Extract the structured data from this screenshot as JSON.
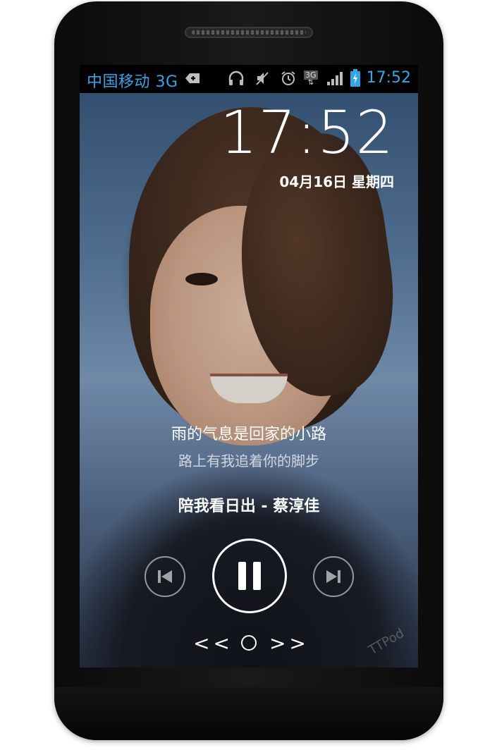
{
  "statusbar": {
    "carrier": "中国移动 3G",
    "network_badge": "3G",
    "time": "17:52",
    "icons": [
      "plus-box-icon",
      "headphones-icon",
      "mute-icon",
      "alarm-icon",
      "network-3g-icon",
      "signal-icon",
      "battery-charging-icon"
    ],
    "accent": "#2fa6e8"
  },
  "lockscreen": {
    "clock": "17:52",
    "date": "04月16日  星期四"
  },
  "music": {
    "lyric_current": "雨的气息是回家的小路",
    "lyric_next": "路上有我追着你的脚步",
    "song_title": "陪我看日出 - 蔡淳佳",
    "watermark": "TTPod",
    "controls": {
      "prev_icon": "previous-track-icon",
      "play_icon": "pause-icon",
      "next_icon": "next-track-icon"
    }
  },
  "unlock": {
    "left_arrows": "< <",
    "right_arrows": "> >"
  }
}
